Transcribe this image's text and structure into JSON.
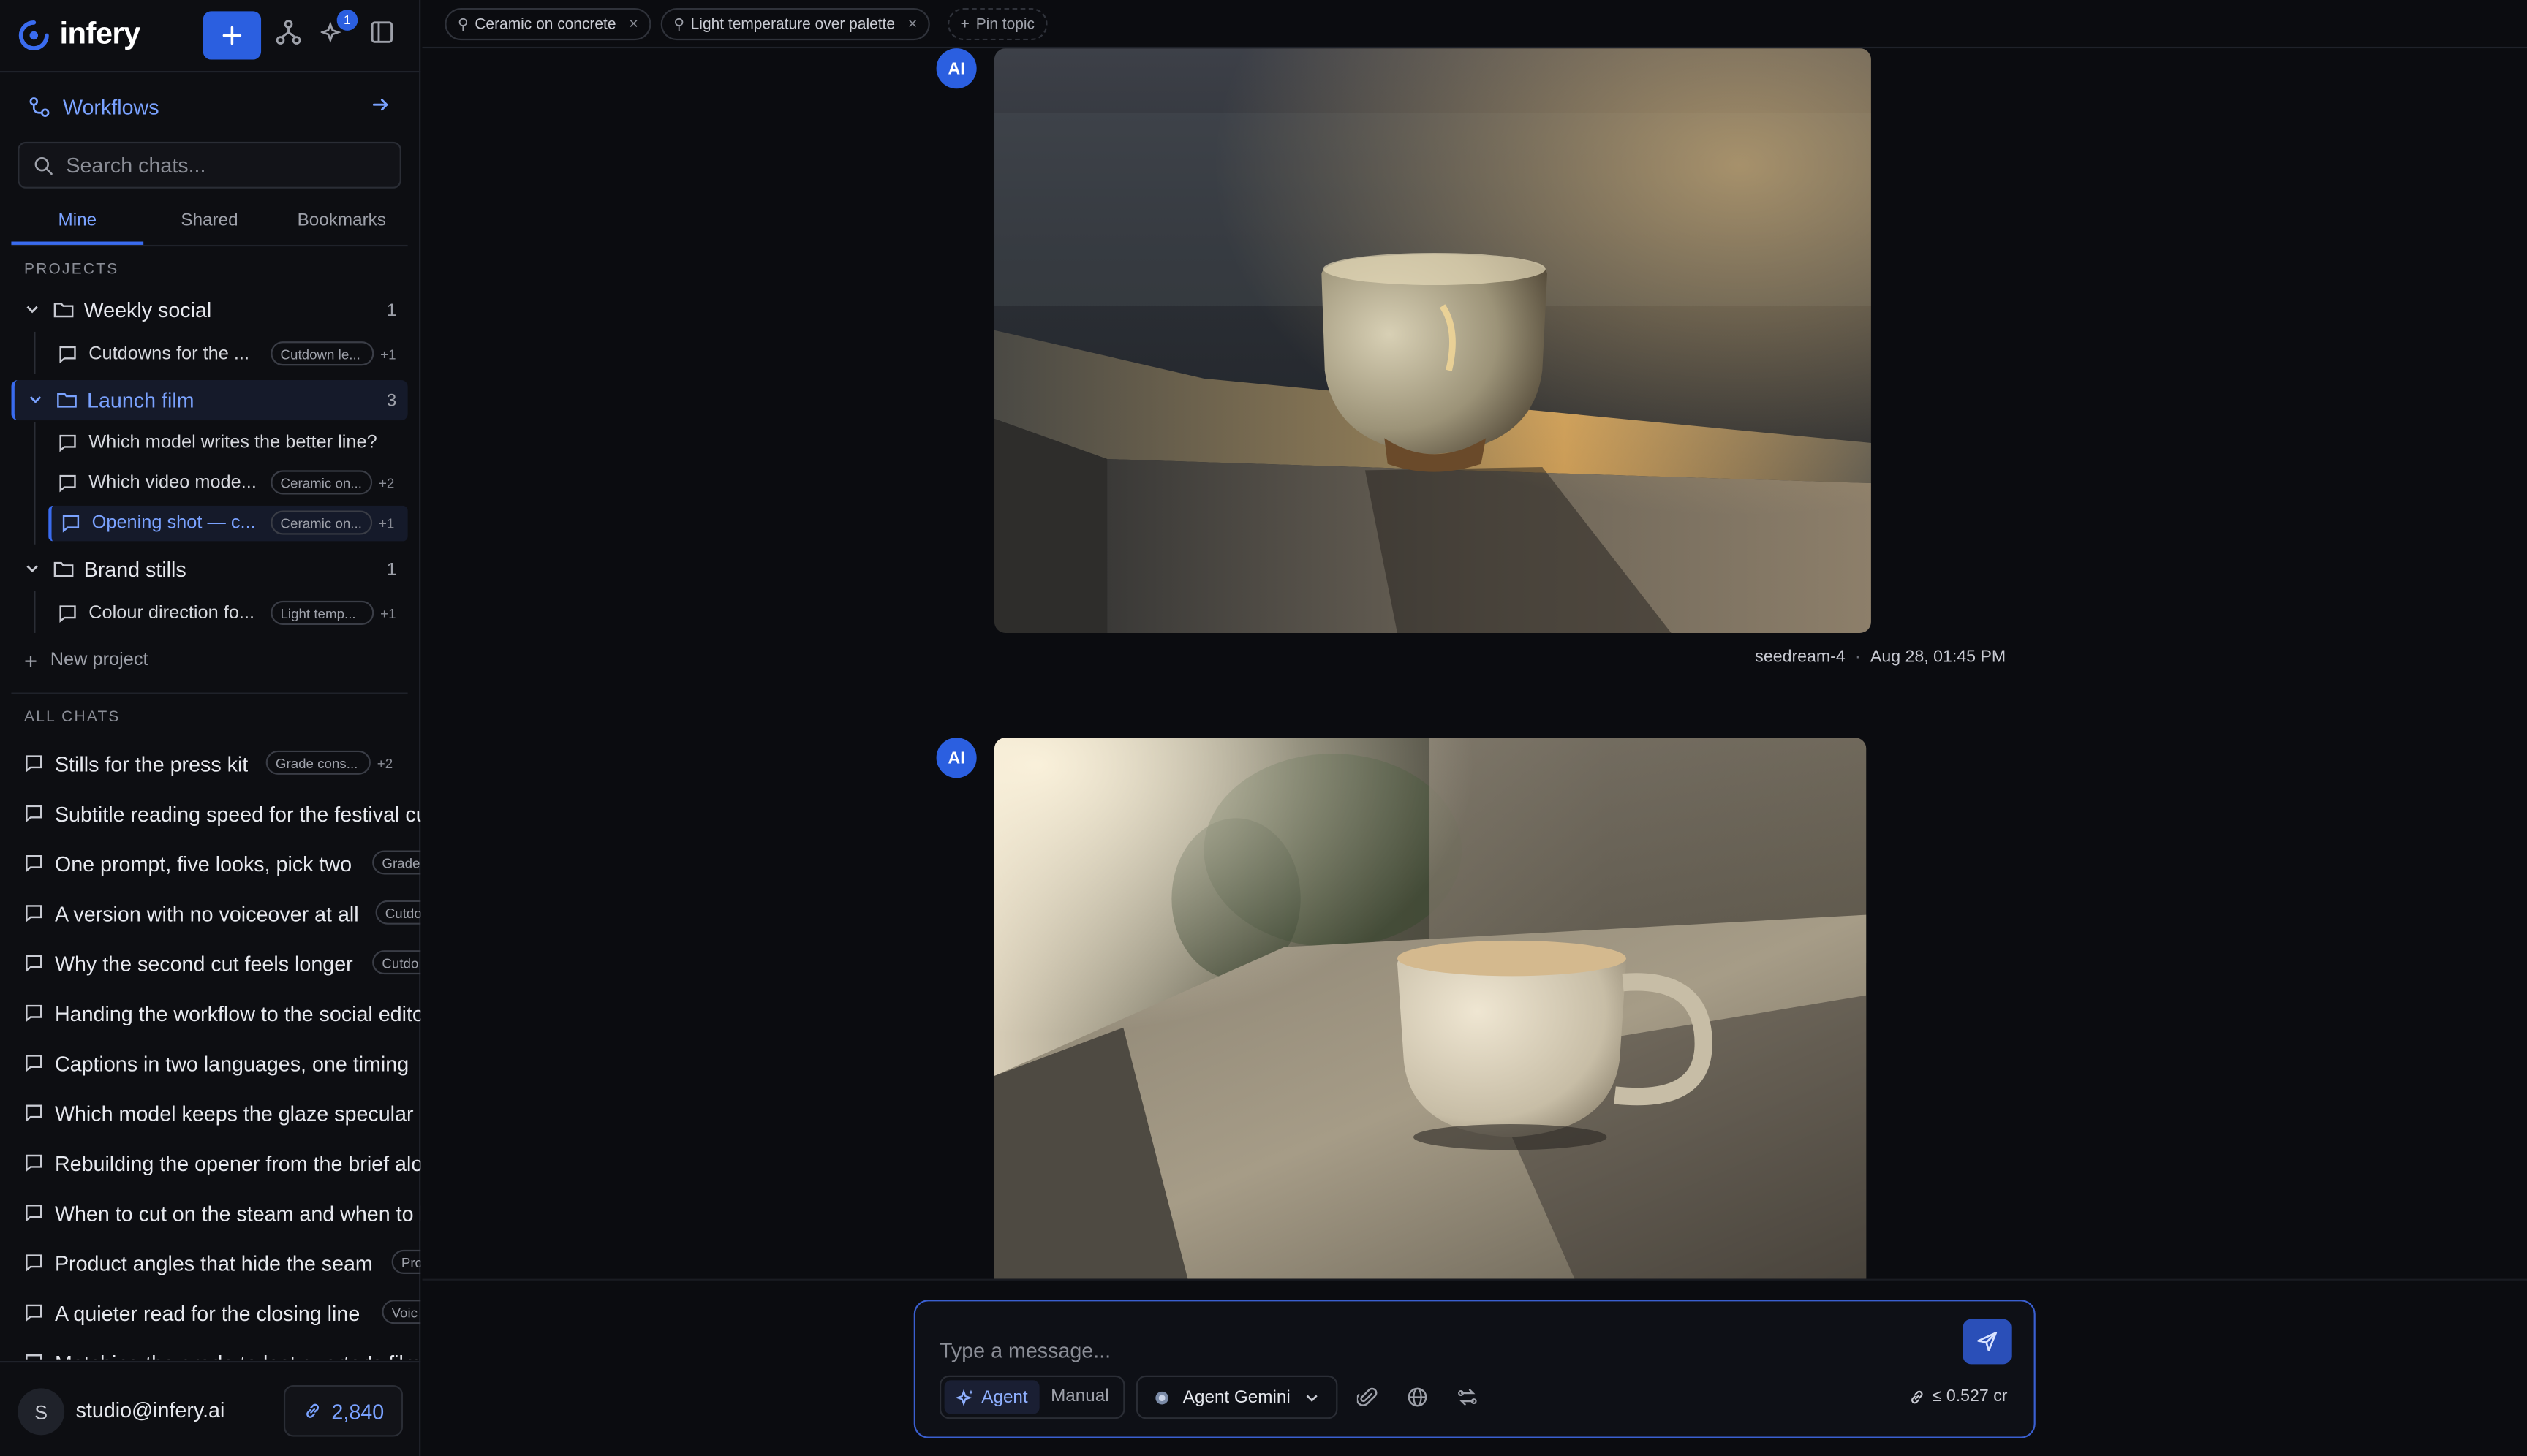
{
  "app": {
    "name": "infery",
    "notifications_count": "1"
  },
  "sidebar": {
    "workflows_label": "Workflows",
    "search_placeholder": "Search chats...",
    "tabs": [
      "Mine",
      "Shared",
      "Bookmarks"
    ],
    "projects_heading": "PROJECTS",
    "projects": [
      {
        "name": "Weekly social",
        "count": "1",
        "chats": [
          {
            "title": "Cutdowns for the ...",
            "tag": "Cutdown le...",
            "extra": "+1"
          }
        ]
      },
      {
        "name": "Launch film",
        "count": "3",
        "chats": [
          {
            "title": "Which model writes the better line?",
            "tag": "",
            "extra": ""
          },
          {
            "title": "Which video mode...",
            "tag": "Ceramic on...",
            "extra": "+2"
          },
          {
            "title": "Opening shot — c...",
            "tag": "Ceramic on...",
            "extra": "+1"
          }
        ]
      },
      {
        "name": "Brand stills",
        "count": "1",
        "chats": [
          {
            "title": "Colour direction fo...",
            "tag": "Light temp...",
            "extra": "+1"
          }
        ]
      }
    ],
    "new_project_label": "New project",
    "all_chats_heading": "ALL CHATS",
    "all_chats": [
      {
        "title": "Stills for the press kit",
        "tag": "Grade cons...",
        "extra": "+2"
      },
      {
        "title": "Subtitle reading speed for the festival cut",
        "tag": "",
        "extra": ""
      },
      {
        "title": "One prompt, five looks, pick two",
        "tag": "Grade",
        "extra": ""
      },
      {
        "title": "A version with no voiceover at all",
        "tag": "Cutdo",
        "extra": ""
      },
      {
        "title": "Why the second cut feels longer",
        "tag": "Cutdo",
        "extra": ""
      },
      {
        "title": "Handing the workflow to the social editor",
        "tag": "",
        "extra": ""
      },
      {
        "title": "Captions in two languages, one timing",
        "tag": "",
        "extra": ""
      },
      {
        "title": "Which model keeps the glaze specular",
        "tag": "",
        "extra": ""
      },
      {
        "title": "Rebuilding the opener from the brief alone",
        "tag": "",
        "extra": ""
      },
      {
        "title": "When to cut on the steam and when to hold",
        "tag": "",
        "extra": ""
      },
      {
        "title": "Product angles that hide the seam",
        "tag": "Pro",
        "extra": ""
      },
      {
        "title": "A quieter read for the closing line",
        "tag": "Voic",
        "extra": ""
      },
      {
        "title": "Matching the grade to last quarter's film",
        "tag": "",
        "extra": ""
      }
    ],
    "user": {
      "initial": "S",
      "email": "studio@infery.ai",
      "credits": "2,840"
    }
  },
  "pins": [
    {
      "label": "Ceramic on concrete"
    },
    {
      "label": "Light temperature over palette"
    }
  ],
  "pin_topic_label": "Pin topic",
  "messages": [
    {
      "badge": "AI",
      "model": "seedream-4",
      "timestamp": "Aug 28, 01:45 PM"
    },
    {
      "badge": "AI"
    }
  ],
  "composer": {
    "placeholder": "Type a message...",
    "mode_agent": "Agent",
    "mode_manual": "Manual",
    "model": "Agent Gemini",
    "cost": "≤ 0.527 cr"
  },
  "colors": {
    "accent": "#2b5fe0",
    "link": "#7aa2ff",
    "background": "#0b0c10"
  }
}
